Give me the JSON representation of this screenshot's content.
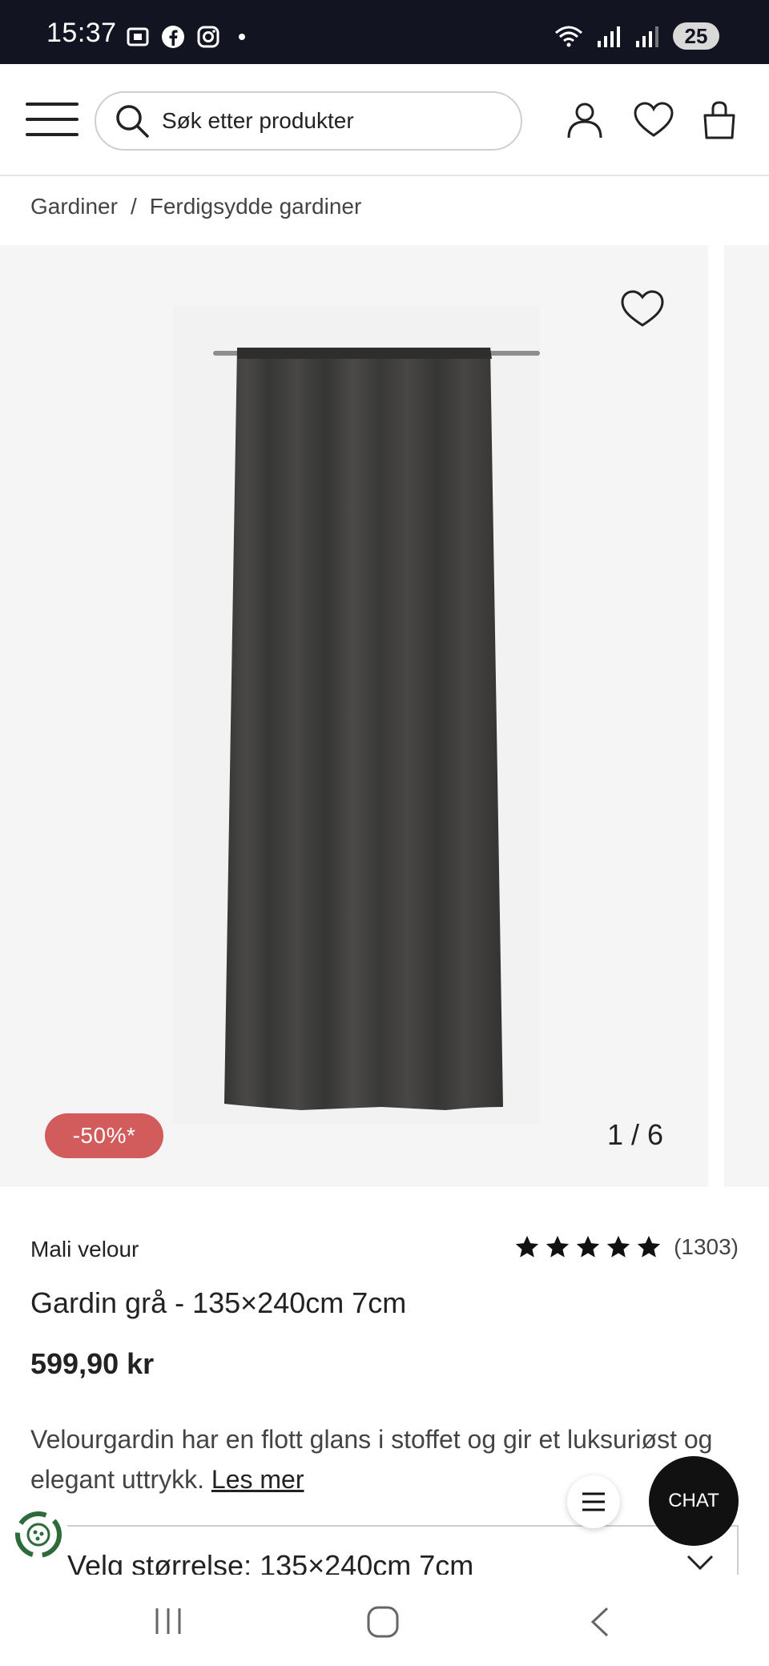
{
  "status_bar": {
    "time": "15:37",
    "battery": "25",
    "left_icons": [
      "screenshot-icon",
      "facebook-icon",
      "instagram-icon",
      "dot-icon"
    ],
    "right_icons": [
      "wifi-icon",
      "signal-icon",
      "signal-icon",
      "battery-icon"
    ]
  },
  "header": {
    "search_placeholder": "Søk etter produkter",
    "icons": [
      "menu-icon",
      "search-icon",
      "user-icon",
      "heart-icon",
      "bag-icon"
    ]
  },
  "breadcrumb": {
    "items": [
      "Gardiner",
      "Ferdigsydde gardiner"
    ],
    "separator": "/"
  },
  "gallery": {
    "discount": "-50%*",
    "counter": "1 / 6"
  },
  "product": {
    "brand": "Mali velour",
    "rating_stars": 5,
    "rating_count": "(1303)",
    "title": "Gardin grå - 135×240cm 7cm",
    "price": "599,90 kr",
    "description": "Velourgardin har en flott glans i stoffet og gir et luksuriøst og elegant uttrykk.",
    "read_more": "Les mer",
    "size_label": "Velg størrelse: 135×240cm 7cm"
  },
  "floating": {
    "chat_label": "CHAT"
  },
  "colors": {
    "status_bar_bg": "#121521",
    "discount_bg": "#d25c5c",
    "chat_bg": "#111111",
    "curtain": "#3e3e3c"
  }
}
